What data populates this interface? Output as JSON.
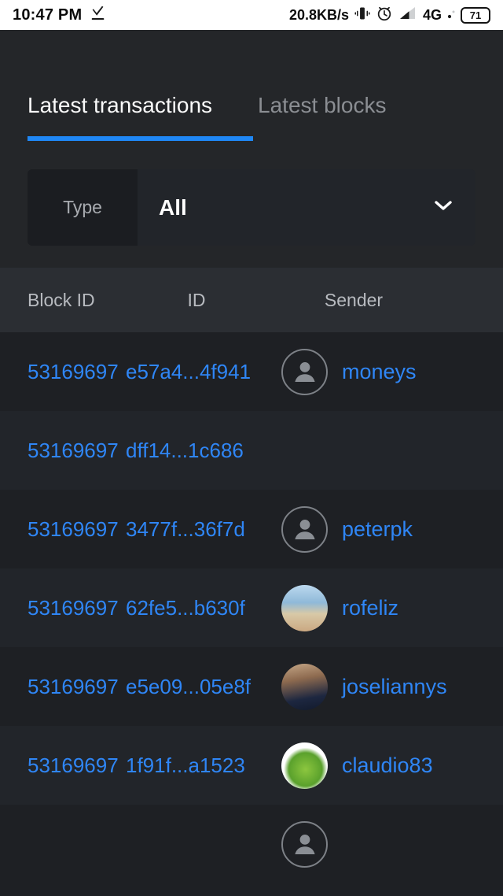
{
  "statusbar": {
    "clock": "10:47 PM",
    "download_icon": "download-check-icon",
    "network_speed": "20.8KB/s",
    "vibrate_icon": "vibrate-icon",
    "alarm_icon": "alarm-clock-icon",
    "signal_icon": "signal-bars-icon",
    "network_type": "4G",
    "dot_icon": "small-dot-icon",
    "battery_level": "71",
    "bg": "#ffffff",
    "fg": "#0c0c0c"
  },
  "tabs": {
    "items": [
      {
        "label": "Latest transactions",
        "active": true
      },
      {
        "label": "Latest blocks",
        "active": false
      }
    ],
    "accent": "#1f87f5"
  },
  "filter": {
    "label": "Type",
    "value": "All",
    "chevron_icon": "chevron-down-icon"
  },
  "table": {
    "columns": [
      "Block ID",
      "ID",
      "Sender"
    ],
    "rows": [
      {
        "block_id": "53169697",
        "id": "e57a4...4f941",
        "sender": "moneys",
        "sender_avatar": "generic-person-icon",
        "receiver_avatar": "photo-room"
      },
      {
        "block_id": "53169697",
        "id": "dff14...1c686",
        "sender": "",
        "sender_avatar": "",
        "receiver_avatar": ""
      },
      {
        "block_id": "53169697",
        "id": "3477f...36f7d",
        "sender": "peterpk",
        "sender_avatar": "generic-person-icon",
        "receiver_avatar": "photo-mild"
      },
      {
        "block_id": "53169697",
        "id": "62fe5...b630f",
        "sender": "rofeliz",
        "sender_avatar": "photo-sky",
        "receiver_avatar": "photo-brown"
      },
      {
        "block_id": "53169697",
        "id": "e5e09...05e8f",
        "sender": "joseliannys",
        "sender_avatar": "photo-girl",
        "receiver_avatar": "photo-orange"
      },
      {
        "block_id": "53169697",
        "id": "1f91f...a1523",
        "sender": "claudio83",
        "sender_avatar": "photo-green",
        "receiver_avatar": "photo-leaf"
      }
    ],
    "link_color": "#2f86f6",
    "header_bg": "#2b2e33"
  }
}
